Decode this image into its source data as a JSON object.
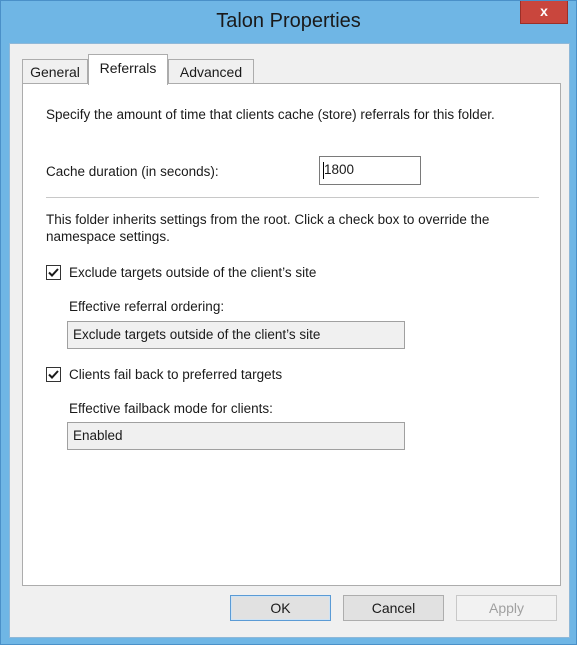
{
  "window": {
    "title": "Talon Properties",
    "close_label": "x"
  },
  "tabs": [
    {
      "label": "General",
      "active": false
    },
    {
      "label": "Referrals",
      "active": true
    },
    {
      "label": "Advanced",
      "active": false
    }
  ],
  "referrals": {
    "description": "Specify the amount of time that clients cache (store) referrals for this folder.",
    "cache_label": "Cache duration (in seconds):",
    "cache_value": "1800",
    "inherit_text": "This folder inherits settings from the root. Click a check box to override the namespace settings.",
    "exclude_targets": {
      "label": "Exclude targets outside of the client’s site",
      "checked": true,
      "effective_label": "Effective referral ordering:",
      "effective_value": "Exclude targets outside of the client’s site"
    },
    "failback": {
      "label": "Clients fail back to preferred targets",
      "checked": true,
      "effective_label": "Effective failback mode for clients:",
      "effective_value": "Enabled"
    }
  },
  "buttons": {
    "ok": "OK",
    "cancel": "Cancel",
    "apply": "Apply"
  },
  "colors": {
    "titlebar": "#6fb6e5",
    "close": "#c9463d"
  }
}
